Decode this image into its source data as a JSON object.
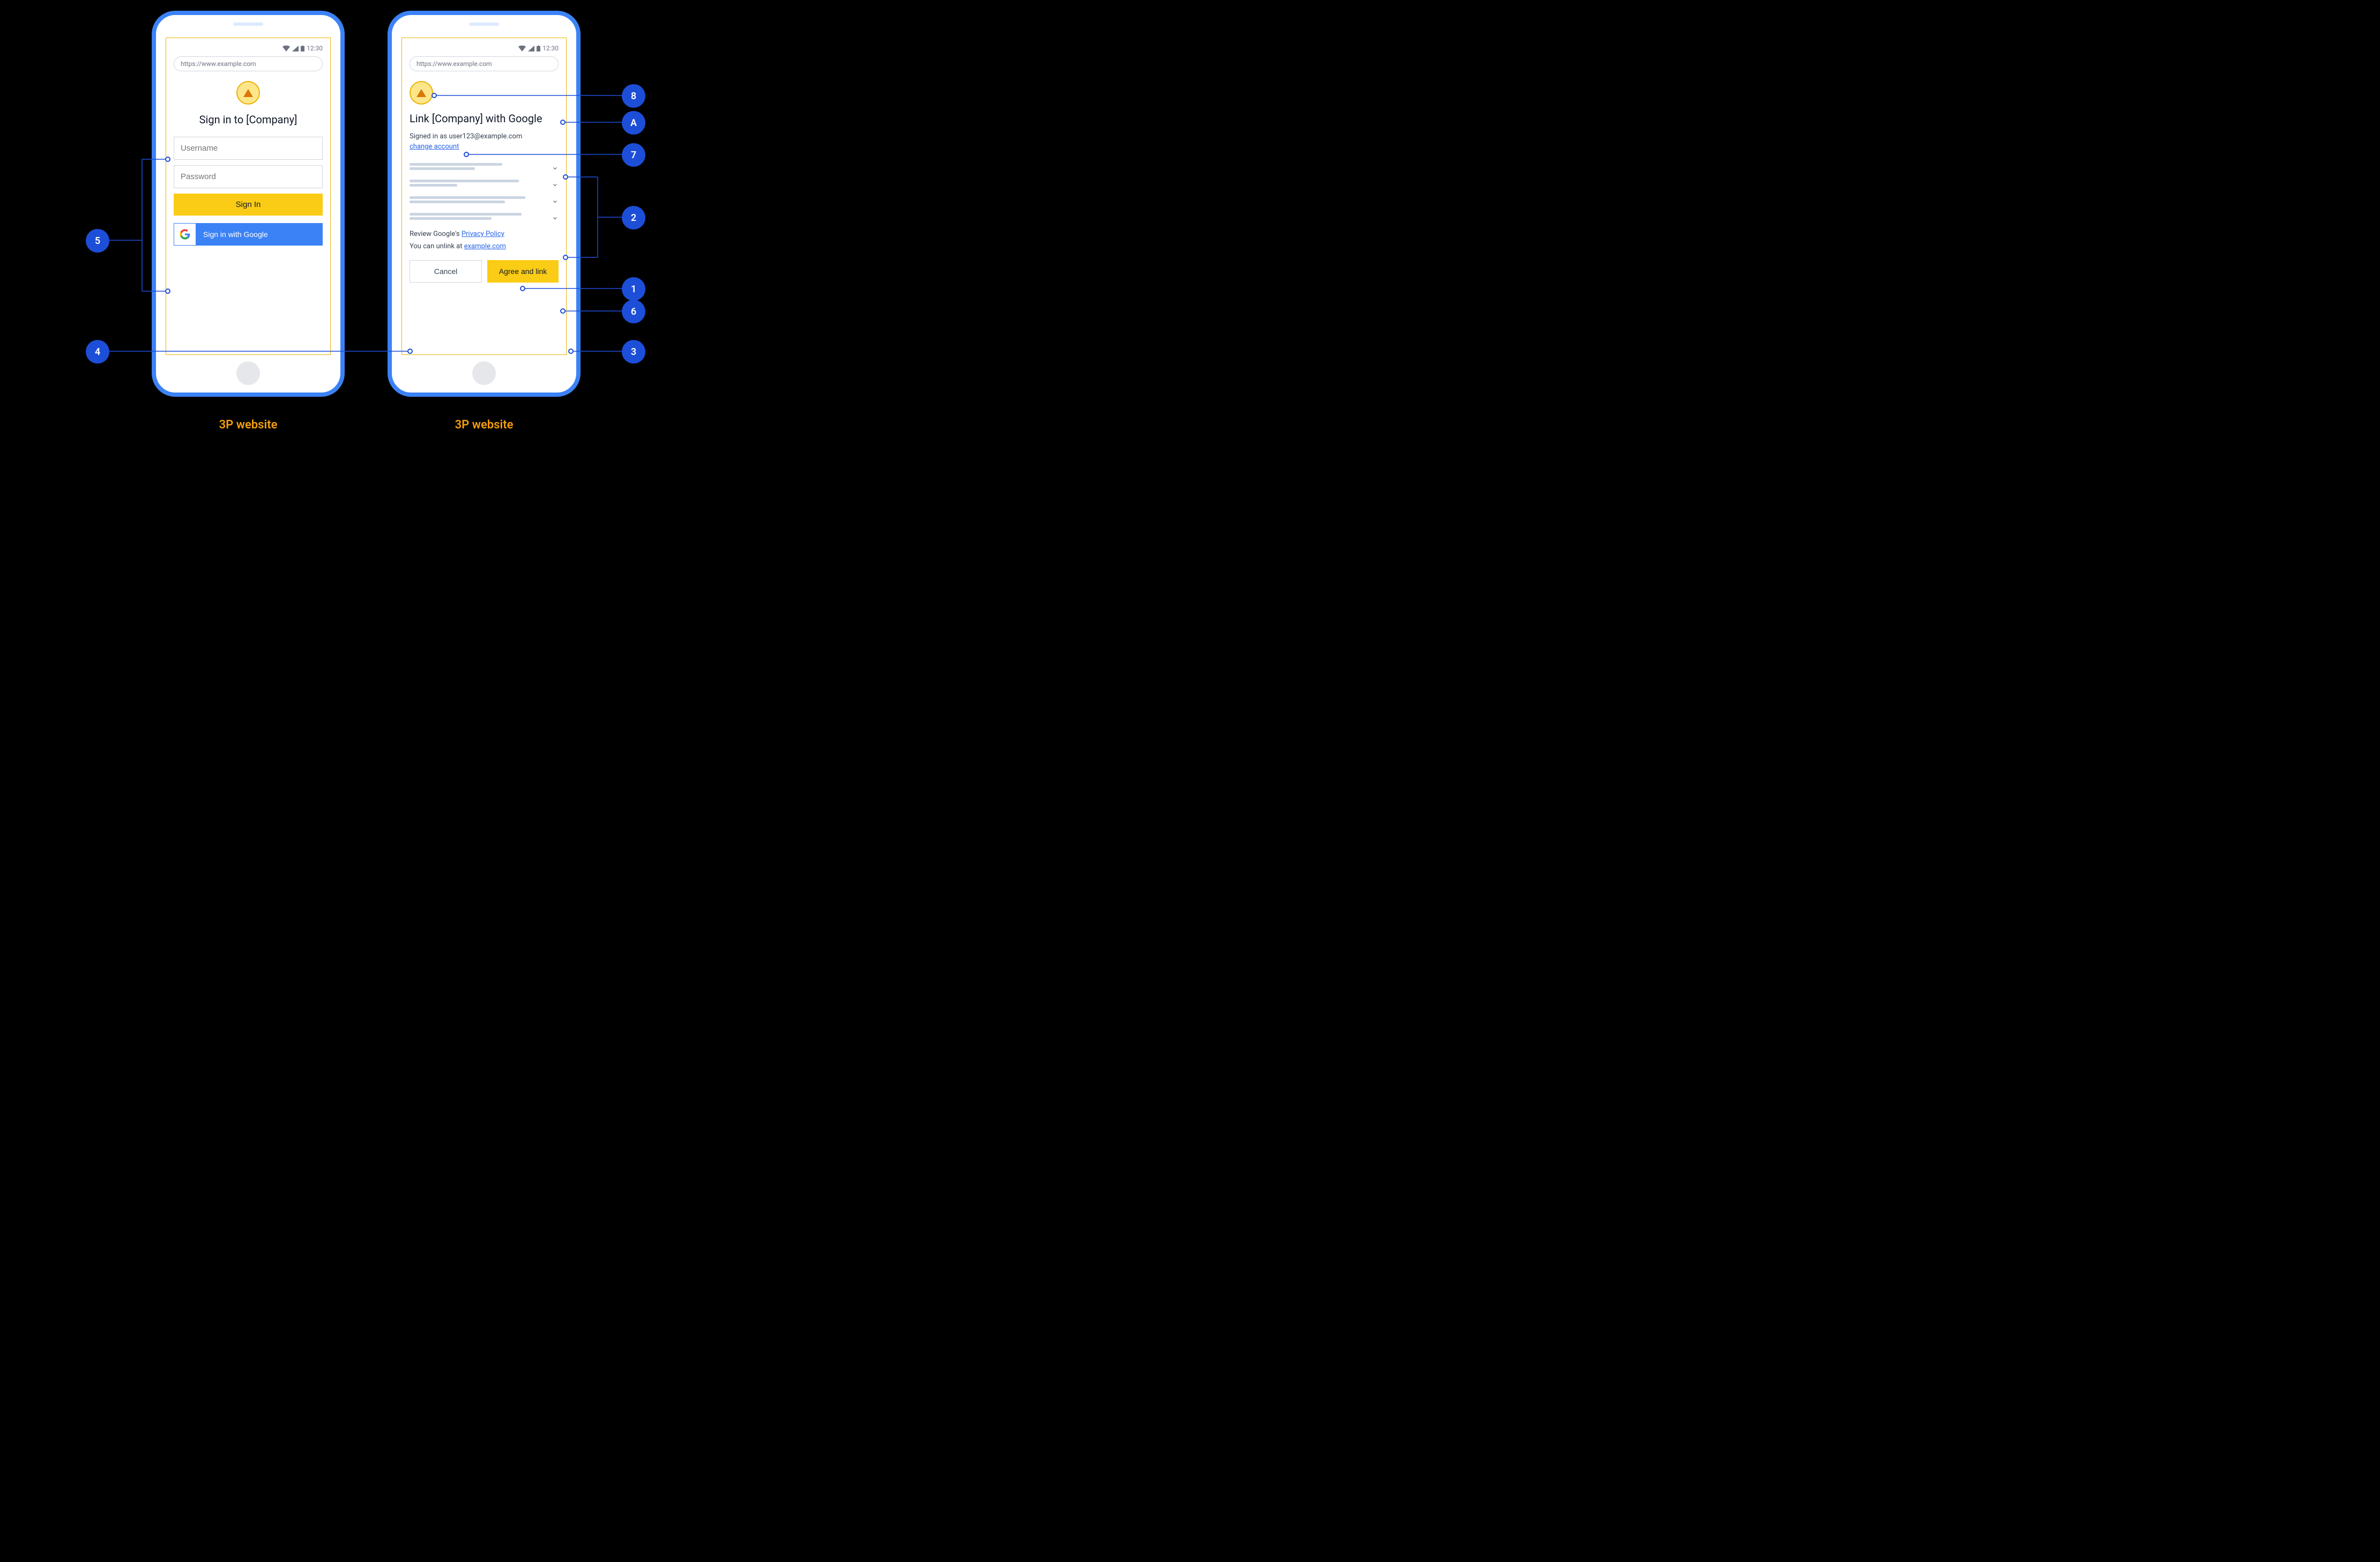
{
  "status": {
    "time": "12:30"
  },
  "url": "https://www.example.com",
  "phone1": {
    "title": "Sign in to [Company]",
    "username_ph": "Username",
    "password_ph": "Password",
    "signin": "Sign In",
    "google": "Sign in with Google",
    "caption": "3P website"
  },
  "phone2": {
    "title": "Link [Company] with Google",
    "signed_in": "Signed in as user123@example.com",
    "change": "change account",
    "review_prefix": "Review Google's ",
    "privacy": "Privacy Policy",
    "unlink_prefix": "You can unlink at ",
    "unlink_link": "example.com",
    "cancel": "Cancel",
    "agree": "Agree and link",
    "caption": "3P website"
  },
  "annotations": {
    "a5": "5",
    "a4": "4",
    "a8": "8",
    "aA": "A",
    "a7": "7",
    "a2": "2",
    "a1": "1",
    "a6": "6",
    "a3": "3"
  }
}
